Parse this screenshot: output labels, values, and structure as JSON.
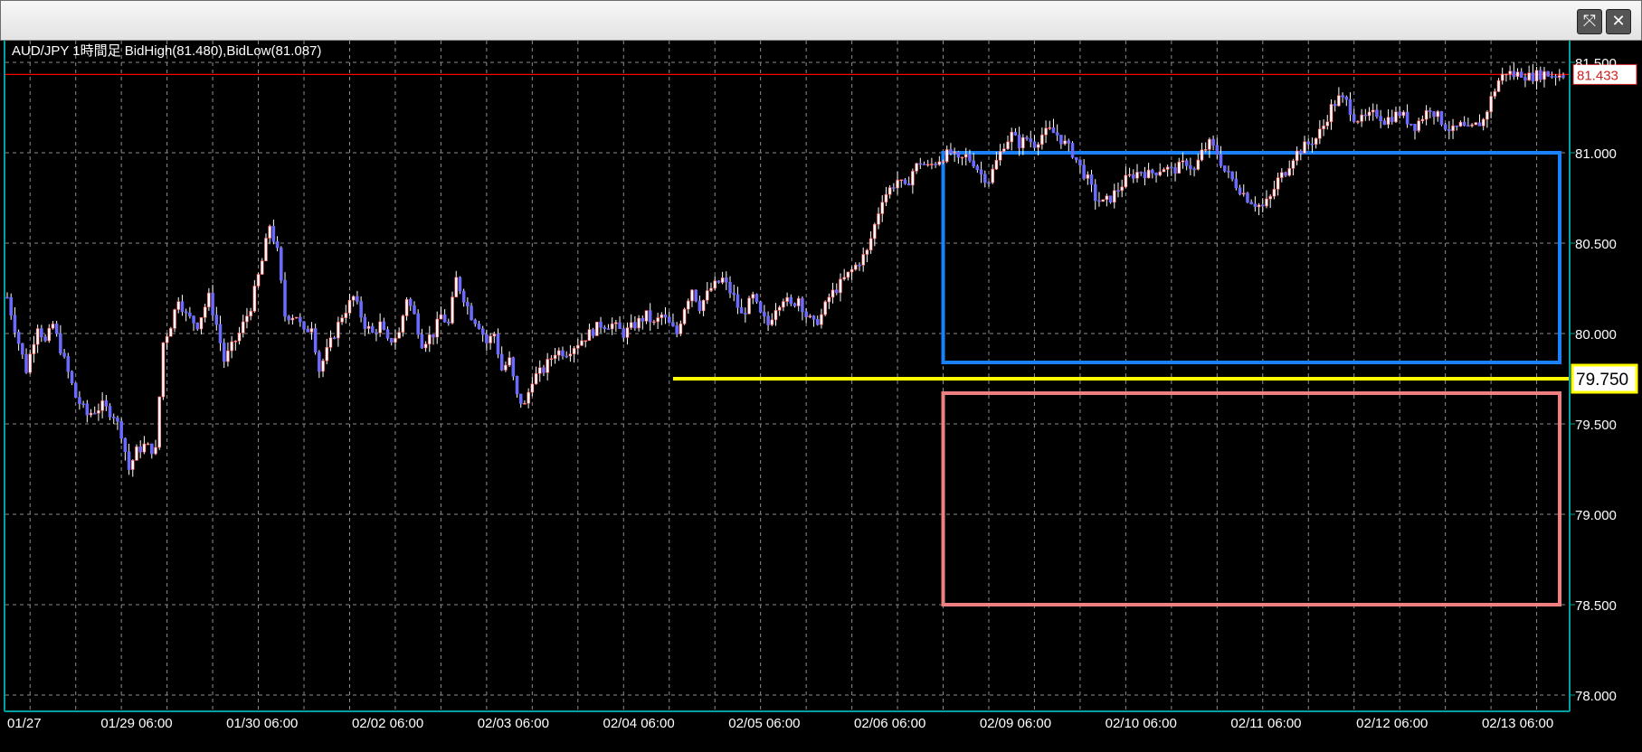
{
  "window": {
    "restore_icon": "expand-arrows-icon",
    "close_icon": "close-icon",
    "restore_glyph": "⤧",
    "close_glyph": "✕"
  },
  "colors": {
    "background": "#000000",
    "grid": "#8c8c8c",
    "axis": "#00a0a0",
    "bull_body": "#ffffff",
    "bear_body": "#6b6bff",
    "bull_border": "#ff5a5a",
    "wick": "#ffffff",
    "current_price_line": "#ff0000",
    "current_price_box": "#cc2222",
    "yellow_level": "#ffff00",
    "blue_box": "#1a82ff",
    "red_box": "#f08080"
  },
  "chart_data": {
    "type": "candlestick",
    "title": "AUD/JPY 1時間足  BidHigh(81.480),BidLow(81.087)",
    "ylim": [
      77.92,
      81.62
    ],
    "y_ticks": [
      "78.000",
      "78.500",
      "79.000",
      "79.500",
      "80.000",
      "80.500",
      "81.000",
      "81.500"
    ],
    "y_tick_values": [
      78.0,
      78.5,
      79.0,
      79.5,
      80.0,
      80.5,
      81.0,
      81.5
    ],
    "x_ticks": [
      "01/27",
      "01/29 06:00",
      "01/30 06:00",
      "02/02 06:00",
      "02/03 06:00",
      "02/04 06:00",
      "02/05 06:00",
      "02/06 06:00",
      "02/09 06:00",
      "02/10 06:00",
      "02/11 06:00",
      "02/12 06:00",
      "02/13 06:00"
    ],
    "x_tick_index": [
      0,
      36,
      69,
      102,
      135,
      168,
      201,
      234,
      267,
      300,
      333,
      366,
      399
    ],
    "candle_count": 410,
    "current_price": 81.433,
    "current_price_label": "81.433",
    "horizontal_level": {
      "value": 79.75,
      "label": "79.750",
      "start_index": 175
    },
    "boxes": [
      {
        "name": "range-box-blue",
        "start_index": 246,
        "end_index": 410,
        "top": 81.0,
        "bottom": 79.84
      },
      {
        "name": "target-box-red",
        "start_index": 246,
        "end_index": 410,
        "top": 79.67,
        "bottom": 78.5
      }
    ],
    "anchors": [
      [
        0,
        80.2
      ],
      [
        3,
        79.95
      ],
      [
        5,
        79.8
      ],
      [
        8,
        80.05
      ],
      [
        10,
        79.95
      ],
      [
        12,
        80.05
      ],
      [
        15,
        79.85
      ],
      [
        18,
        79.65
      ],
      [
        21,
        79.55
      ],
      [
        25,
        79.6
      ],
      [
        28,
        79.55
      ],
      [
        30,
        79.45
      ],
      [
        32,
        79.25
      ],
      [
        34,
        79.35
      ],
      [
        36,
        79.38
      ],
      [
        39,
        79.35
      ],
      [
        41,
        79.95
      ],
      [
        43,
        80.05
      ],
      [
        45,
        80.2
      ],
      [
        47,
        80.1
      ],
      [
        50,
        80.05
      ],
      [
        53,
        80.2
      ],
      [
        55,
        80.05
      ],
      [
        57,
        79.85
      ],
      [
        61,
        80.0
      ],
      [
        64,
        80.15
      ],
      [
        67,
        80.4
      ],
      [
        69,
        80.6
      ],
      [
        71,
        80.45
      ],
      [
        73,
        80.1
      ],
      [
        76,
        80.1
      ],
      [
        78,
        80.0
      ],
      [
        80,
        80.05
      ],
      [
        82,
        79.8
      ],
      [
        85,
        79.95
      ],
      [
        88,
        80.1
      ],
      [
        91,
        80.2
      ],
      [
        94,
        80.05
      ],
      [
        96,
        80.0
      ],
      [
        98,
        80.05
      ],
      [
        100,
        79.95
      ],
      [
        103,
        80.0
      ],
      [
        105,
        80.2
      ],
      [
        107,
        80.1
      ],
      [
        109,
        79.95
      ],
      [
        112,
        80.0
      ],
      [
        114,
        80.1
      ],
      [
        116,
        80.05
      ],
      [
        118,
        80.3
      ],
      [
        120,
        80.2
      ],
      [
        122,
        80.1
      ],
      [
        124,
        80.05
      ],
      [
        126,
        79.95
      ],
      [
        128,
        80.0
      ],
      [
        130,
        79.8
      ],
      [
        132,
        79.85
      ],
      [
        134,
        79.65
      ],
      [
        136,
        79.6
      ],
      [
        138,
        79.75
      ],
      [
        141,
        79.8
      ],
      [
        144,
        79.9
      ],
      [
        147,
        79.9
      ],
      [
        150,
        79.95
      ],
      [
        153,
        80.0
      ],
      [
        156,
        80.05
      ],
      [
        159,
        80.05
      ],
      [
        162,
        80.0
      ],
      [
        165,
        80.05
      ],
      [
        168,
        80.1
      ],
      [
        170,
        80.05
      ],
      [
        172,
        80.1
      ],
      [
        174,
        80.05
      ],
      [
        176,
        80.0
      ],
      [
        178,
        80.15
      ],
      [
        180,
        80.25
      ],
      [
        182,
        80.15
      ],
      [
        185,
        80.25
      ],
      [
        188,
        80.3
      ],
      [
        191,
        80.2
      ],
      [
        193,
        80.1
      ],
      [
        196,
        80.2
      ],
      [
        198,
        80.1
      ],
      [
        200,
        80.05
      ],
      [
        202,
        80.15
      ],
      [
        204,
        80.2
      ],
      [
        206,
        80.15
      ],
      [
        208,
        80.2
      ],
      [
        210,
        80.1
      ],
      [
        212,
        80.05
      ],
      [
        214,
        80.1
      ],
      [
        216,
        80.2
      ],
      [
        218,
        80.25
      ],
      [
        220,
        80.3
      ],
      [
        222,
        80.35
      ],
      [
        224,
        80.4
      ],
      [
        226,
        80.45
      ],
      [
        228,
        80.6
      ],
      [
        230,
        80.75
      ],
      [
        232,
        80.8
      ],
      [
        234,
        80.85
      ],
      [
        236,
        80.8
      ],
      [
        238,
        80.9
      ],
      [
        240,
        80.95
      ],
      [
        242,
        80.92
      ],
      [
        244,
        80.95
      ],
      [
        246,
        80.98
      ],
      [
        248,
        81.0
      ],
      [
        250,
        80.95
      ],
      [
        252,
        80.98
      ],
      [
        254,
        80.95
      ],
      [
        256,
        80.88
      ],
      [
        258,
        80.85
      ],
      [
        260,
        80.95
      ],
      [
        262,
        81.05
      ],
      [
        264,
        81.1
      ],
      [
        266,
        81.05
      ],
      [
        268,
        81.08
      ],
      [
        270,
        81.05
      ],
      [
        272,
        81.1
      ],
      [
        274,
        81.12
      ],
      [
        276,
        81.1
      ],
      [
        278,
        81.05
      ],
      [
        280,
        81.0
      ],
      [
        282,
        80.92
      ],
      [
        284,
        80.85
      ],
      [
        286,
        80.75
      ],
      [
        288,
        80.72
      ],
      [
        290,
        80.75
      ],
      [
        292,
        80.8
      ],
      [
        294,
        80.85
      ],
      [
        296,
        80.88
      ],
      [
        298,
        80.9
      ],
      [
        300,
        80.88
      ],
      [
        302,
        80.9
      ],
      [
        304,
        80.92
      ],
      [
        306,
        80.9
      ],
      [
        308,
        80.92
      ],
      [
        310,
        80.95
      ],
      [
        312,
        80.9
      ],
      [
        314,
        81.0
      ],
      [
        316,
        81.05
      ],
      [
        318,
        81.0
      ],
      [
        320,
        80.9
      ],
      [
        322,
        80.85
      ],
      [
        324,
        80.8
      ],
      [
        326,
        80.75
      ],
      [
        328,
        80.72
      ],
      [
        330,
        80.7
      ],
      [
        332,
        80.75
      ],
      [
        334,
        80.85
      ],
      [
        336,
        80.9
      ],
      [
        338,
        80.98
      ],
      [
        340,
        81.02
      ],
      [
        342,
        81.05
      ],
      [
        344,
        81.08
      ],
      [
        346,
        81.15
      ],
      [
        348,
        81.25
      ],
      [
        350,
        81.3
      ],
      [
        352,
        81.28
      ],
      [
        354,
        81.2
      ],
      [
        356,
        81.18
      ],
      [
        358,
        81.2
      ],
      [
        360,
        81.22
      ],
      [
        362,
        81.18
      ],
      [
        364,
        81.2
      ],
      [
        366,
        81.22
      ],
      [
        368,
        81.18
      ],
      [
        370,
        81.15
      ],
      [
        372,
        81.2
      ],
      [
        374,
        81.25
      ],
      [
        376,
        81.2
      ],
      [
        378,
        81.15
      ],
      [
        380,
        81.12
      ],
      [
        382,
        81.15
      ],
      [
        384,
        81.12
      ],
      [
        386,
        81.15
      ],
      [
        388,
        81.18
      ],
      [
        390,
        81.3
      ],
      [
        392,
        81.4
      ],
      [
        394,
        81.45
      ],
      [
        396,
        81.43
      ],
      [
        398,
        81.44
      ],
      [
        400,
        81.42
      ],
      [
        402,
        81.43
      ],
      [
        404,
        81.44
      ],
      [
        406,
        81.43
      ],
      [
        409,
        81.433
      ]
    ]
  }
}
